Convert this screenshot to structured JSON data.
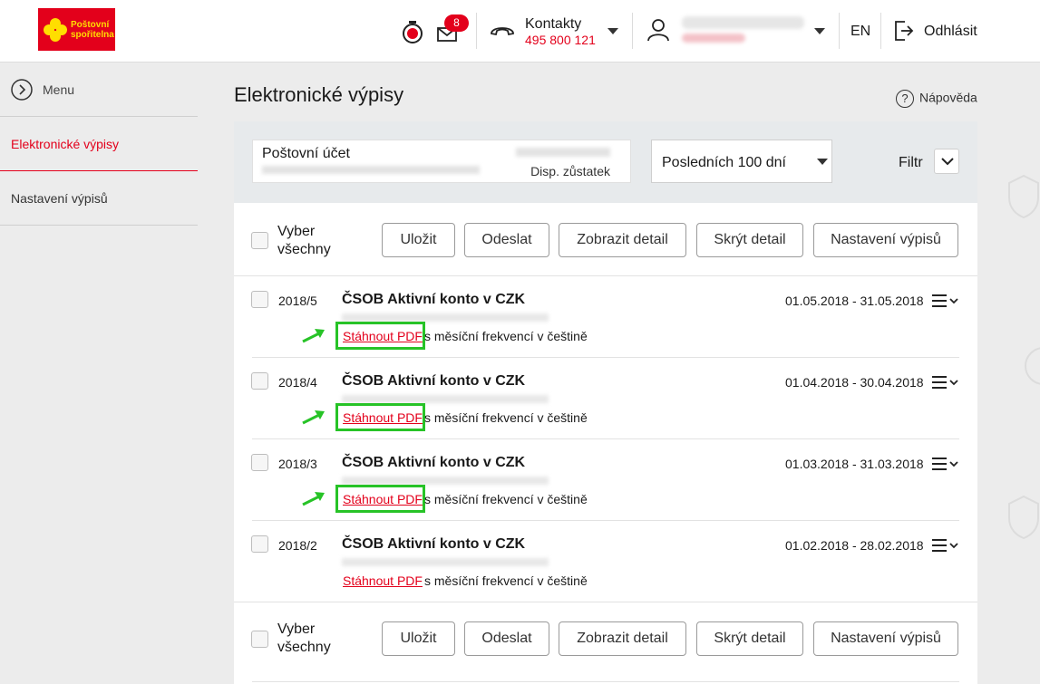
{
  "header": {
    "logo_line1": "Poštovní",
    "logo_line2": "spořitelna",
    "mail_badge": "8",
    "contacts_label": "Kontakty",
    "contacts_phone": "495 800 121",
    "lang": "EN",
    "logout_label": "Odhlásit"
  },
  "sidebar": {
    "menu_label": "Menu",
    "items": [
      {
        "label": "Elektronické výpisy",
        "active": true
      },
      {
        "label": "Nastavení výpisů",
        "active": false
      }
    ]
  },
  "main": {
    "title": "Elektronické výpisy",
    "help_label": "Nápověda",
    "filter": {
      "account_name": "Poštovní účet",
      "balance_label": "Disp. zůstatek",
      "period_value": "Posledních 100 dní",
      "filter_label": "Filtr"
    },
    "toolbar": {
      "select_all_line1": "Vyber",
      "select_all_line2": "všechny",
      "buttons": [
        "Uložit",
        "Odeslat",
        "Zobrazit detail",
        "Skrýt detail",
        "Nastavení výpisů"
      ]
    },
    "statements": [
      {
        "period": "2018/5",
        "title": "ČSOB Aktivní konto v CZK",
        "dates": "01.05.2018 - 31.05.2018",
        "download": "Stáhnout PDF",
        "frequency": "s měsíční frekvencí v češtině",
        "highlighted": true
      },
      {
        "period": "2018/4",
        "title": "ČSOB Aktivní konto v CZK",
        "dates": "01.04.2018 - 30.04.2018",
        "download": "Stáhnout PDF",
        "frequency": "s měsíční frekvencí v češtině",
        "highlighted": true
      },
      {
        "period": "2018/3",
        "title": "ČSOB Aktivní konto v CZK",
        "dates": "01.03.2018 - 31.03.2018",
        "download": "Stáhnout PDF",
        "frequency": "s měsíční frekvencí v češtině",
        "highlighted": true
      },
      {
        "period": "2018/2",
        "title": "ČSOB Aktivní konto v CZK",
        "dates": "01.02.2018 - 28.02.2018",
        "download": "Stáhnout PDF",
        "frequency": "s měsíční frekvencí v češtině",
        "highlighted": false
      }
    ]
  },
  "colors": {
    "brand": "#e3001b",
    "logo_yellow": "#ffde00",
    "highlight": "#27c327"
  }
}
